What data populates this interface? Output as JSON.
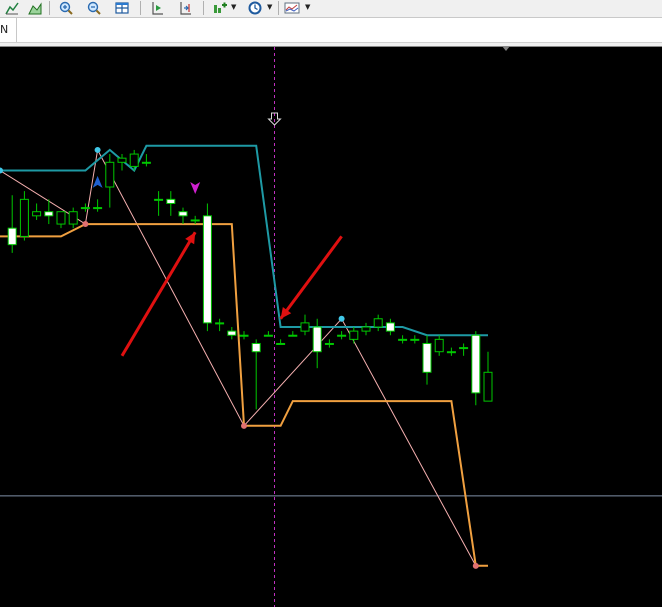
{
  "toolbar": {
    "buttons": [
      {
        "name": "chart-line-icon"
      },
      {
        "name": "chart-area-icon"
      },
      {
        "name": "zoom-in-icon"
      },
      {
        "name": "zoom-out-icon"
      },
      {
        "name": "tile-windows-icon"
      },
      {
        "name": "scroll-chart-icon"
      },
      {
        "name": "chart-shift-icon"
      },
      {
        "name": "add-indicator-icon"
      },
      {
        "name": "periods-clock-icon"
      },
      {
        "name": "templates-icon"
      }
    ]
  },
  "tab": {
    "label": "N"
  },
  "colors": {
    "background": "#000000",
    "candle": "#00c800",
    "upper_line": "#1e9aa5",
    "lower_line": "#f0a040",
    "zigzag": "#f6b0b0",
    "signal_arrow": "#e01010",
    "crosshair": "#c030c0",
    "hline": "#8090a8"
  },
  "chart_data": {
    "type": "candlestick",
    "x": [
      1,
      2,
      3,
      4,
      5,
      6,
      7,
      8,
      9,
      10,
      11,
      12,
      13,
      14,
      15,
      16,
      17,
      18,
      19,
      20,
      21,
      22,
      23,
      24,
      25,
      26,
      27,
      28,
      29,
      30,
      31,
      32,
      33,
      34,
      35,
      36,
      37,
      38,
      39,
      40
    ],
    "candles": [
      {
        "o": 30,
        "h": 38,
        "l": 24,
        "c": 26
      },
      {
        "o": 28,
        "h": 39,
        "l": 27,
        "c": 37
      },
      {
        "o": 33,
        "h": 36,
        "l": 32,
        "c": 34
      },
      {
        "o": 34,
        "h": 37,
        "l": 31,
        "c": 33
      },
      {
        "o": 31,
        "h": 34,
        "l": 30,
        "c": 34
      },
      {
        "o": 31,
        "h": 35,
        "l": 30,
        "c": 34
      },
      {
        "o": 35,
        "h": 36,
        "l": 34,
        "c": 35
      },
      {
        "o": 35,
        "h": 37,
        "l": 34,
        "c": 35
      },
      {
        "o": 40,
        "h": 48,
        "l": 35,
        "c": 46
      },
      {
        "o": 46,
        "h": 48,
        "l": 44,
        "c": 47
      },
      {
        "o": 45,
        "h": 49,
        "l": 44,
        "c": 48
      },
      {
        "o": 46,
        "h": 48,
        "l": 45,
        "c": 46
      },
      {
        "o": 37,
        "h": 39,
        "l": 33,
        "c": 37
      },
      {
        "o": 37,
        "h": 39,
        "l": 33,
        "c": 36
      },
      {
        "o": 34,
        "h": 35,
        "l": 31,
        "c": 33
      },
      {
        "o": 32,
        "h": 33,
        "l": 31,
        "c": 32
      },
      {
        "o": 33,
        "h": 36,
        "l": 5,
        "c": 7
      },
      {
        "o": 7,
        "h": 8,
        "l": 5,
        "c": 7
      },
      {
        "o": 5,
        "h": 6,
        "l": 3,
        "c": 4
      },
      {
        "o": 4,
        "h": 5,
        "l": 3,
        "c": 4
      },
      {
        "o": 2,
        "h": 3,
        "l": -14,
        "c": 0
      },
      {
        "o": 4,
        "h": 5,
        "l": 4,
        "c": 4
      },
      {
        "o": 2,
        "h": 3,
        "l": 2,
        "c": 2
      },
      {
        "o": 4,
        "h": 5,
        "l": 4,
        "c": 4
      },
      {
        "o": 5,
        "h": 9,
        "l": 4,
        "c": 7
      },
      {
        "o": 6,
        "h": 8,
        "l": -4,
        "c": 0
      },
      {
        "o": 2,
        "h": 3,
        "l": 1,
        "c": 2
      },
      {
        "o": 4,
        "h": 5,
        "l": 3,
        "c": 4
      },
      {
        "o": 3,
        "h": 6,
        "l": 2,
        "c": 5
      },
      {
        "o": 5,
        "h": 7,
        "l": 4,
        "c": 6
      },
      {
        "o": 6,
        "h": 9,
        "l": 5,
        "c": 8
      },
      {
        "o": 7,
        "h": 8,
        "l": 4,
        "c": 5
      },
      {
        "o": 3,
        "h": 4,
        "l": 2,
        "c": 3
      },
      {
        "o": 3,
        "h": 4,
        "l": 2,
        "c": 3
      },
      {
        "o": 2,
        "h": 4,
        "l": -8,
        "c": -5
      },
      {
        "o": 0,
        "h": 4,
        "l": -1,
        "c": 3
      },
      {
        "o": 0,
        "h": 1,
        "l": -1,
        "c": 0
      },
      {
        "o": 1,
        "h": 2,
        "l": -1,
        "c": 1
      },
      {
        "o": 4,
        "h": 5,
        "l": -13,
        "c": -10
      },
      {
        "o": -12,
        "h": 0,
        "l": -8,
        "c": -5
      }
    ],
    "upper_line": [
      {
        "x": 0,
        "y": 44
      },
      {
        "x": 7,
        "y": 44
      },
      {
        "x": 9,
        "y": 49
      },
      {
        "x": 11,
        "y": 44
      },
      {
        "x": 12,
        "y": 50
      },
      {
        "x": 21,
        "y": 50
      },
      {
        "x": 23,
        "y": 6
      },
      {
        "x": 33,
        "y": 6
      },
      {
        "x": 35,
        "y": 4
      },
      {
        "x": 40,
        "y": 4
      }
    ],
    "lower_line": [
      {
        "x": 0,
        "y": 28
      },
      {
        "x": 5,
        "y": 28
      },
      {
        "x": 7,
        "y": 31
      },
      {
        "x": 19,
        "y": 31
      },
      {
        "x": 20,
        "y": -18
      },
      {
        "x": 23,
        "y": -18
      },
      {
        "x": 24,
        "y": -12
      },
      {
        "x": 37,
        "y": -12
      },
      {
        "x": 39,
        "y": -52
      },
      {
        "x": 40,
        "y": -52
      }
    ],
    "zigzag": [
      {
        "x": 0,
        "y": 44
      },
      {
        "x": 7,
        "y": 31
      },
      {
        "x": 8,
        "y": 49
      },
      {
        "x": 20,
        "y": -18
      },
      {
        "x": 28,
        "y": 8
      },
      {
        "x": 39,
        "y": -52
      }
    ],
    "pivots": [
      {
        "x": 0,
        "y": 44,
        "kind": "high"
      },
      {
        "x": 8,
        "y": 49,
        "kind": "high"
      },
      {
        "x": 7,
        "y": 31,
        "kind": "low"
      },
      {
        "x": 20,
        "y": -18,
        "kind": "low"
      },
      {
        "x": 28,
        "y": 8,
        "kind": "high"
      },
      {
        "x": 39,
        "y": -52,
        "kind": "low"
      }
    ],
    "signal_arrows": [
      {
        "from": {
          "x": 10,
          "y": -1
        },
        "to": {
          "x": 16,
          "y": 29
        }
      },
      {
        "from": {
          "x": 28,
          "y": 28
        },
        "to": {
          "x": 23,
          "y": 8
        }
      }
    ],
    "markers": [
      {
        "x": 8,
        "y": 41,
        "kind": "up-arrow",
        "color": "#2060d0"
      },
      {
        "x": 16,
        "y": 40,
        "kind": "down-arrow",
        "color": "#d020d0"
      }
    ],
    "crosshair_x": 22.5,
    "hline_y": -35,
    "ylim": [
      -62,
      74
    ],
    "xlim": [
      0,
      54
    ],
    "grid": false
  }
}
